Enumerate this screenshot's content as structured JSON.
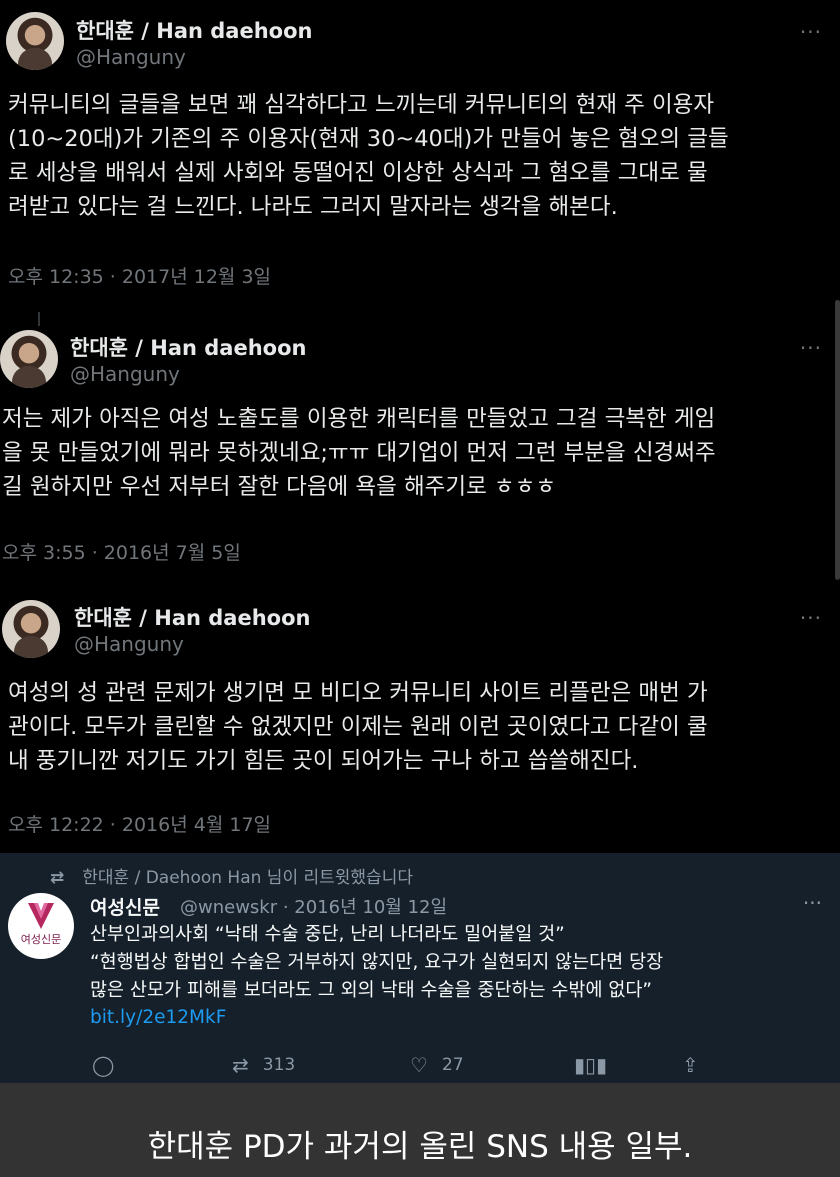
{
  "tweets": [
    {
      "name": "한대훈 / Han daehoon",
      "handle": "@Hanguny",
      "text": "커뮤니티의 글들을 보면 꽤 심각하다고 느끼는데 커뮤니티의 현재 주 이용자\n(10~20대)가 기존의 주 이용자(현재 30~40대)가 만들어 놓은 혐오의 글들\n로 세상을 배워서 실제 사회와 동떨어진 이상한 상식과 그 혐오를 그대로 물\n려받고 있다는 걸 느낀다. 나라도 그러지 말자라는 생각을 해본다.",
      "time": "오후 12:35 · 2017년 12월 3일"
    },
    {
      "name": "한대훈 / Han daehoon",
      "handle": "@Hanguny",
      "text": "저는 제가 아직은 여성 노출도를 이용한 캐릭터를 만들었고 그걸 극복한 게임\n을 못 만들었기에 뭐라 못하겠네요;ㅠㅠ 대기업이 먼저 그런 부분을 신경써주\n길 원하지만 우선 저부터 잘한 다음에 욕을 해주기로 ㅎㅎㅎ",
      "time": "오후 3:55 · 2016년 7월 5일"
    },
    {
      "name": "한대훈 / Han daehoon",
      "handle": "@Hanguny",
      "text": "여성의 성 관련 문제가 생기면 모 비디오 커뮤니티 사이트 리플란은 매번 가\n관이다. 모두가 클린할 수 없겠지만 이제는 원래 이런 곳이였다고 다같이 쿨\n내 풍기니깐 저기도 가기 힘든 곳이 되어가는 구나 하고 씁쓸해진다.",
      "time": "오후 12:22 · 2016년 4월 17일"
    }
  ],
  "retweet": {
    "retweeted_by": "한대훈 / Daehoon Han 님이 리트윗했습니다",
    "avatar_text": "여성신문",
    "name": "여성신문",
    "meta": "@wnewskr · 2016년 10월 12일",
    "text": "산부인과의사회 “낙태 수술 중단, 난리 나더라도 밀어붙일 것”\n“현행법상 합법인 수술은 거부하지 않지만, 요구가 실현되지 않는다면 당장\n많은 산모가 피해를 보더라도 그 외의 낙태 수술을 중단하는 수밖에 없다”",
    "link": "bit.ly/2e12MkF",
    "retweets": "313",
    "likes": "27"
  },
  "more_glyph": "···",
  "caption": "한대훈 PD가 과거의 올린 SNS 내용 일부.",
  "colors": {
    "background": "#000000",
    "retweet_panel": "#15202b",
    "link": "#1d9bf0",
    "caption_bar": "#333333"
  }
}
